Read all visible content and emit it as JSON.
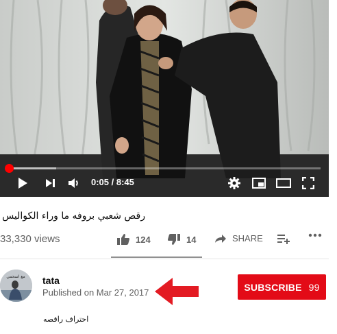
{
  "player": {
    "time": "0:05 / 8:45",
    "progress_fraction": 0.01,
    "buffered_fraction": 0.16
  },
  "video": {
    "title": "رقص شعبي بروفه ما وراء الكواليس",
    "views": "33,330 views"
  },
  "actions": {
    "like_count": "124",
    "dislike_count": "14",
    "share_label": "SHARE"
  },
  "channel": {
    "name": "tata",
    "published": "Published on Mar 27, 2017",
    "avatar_text": "مع اسحمي"
  },
  "subscribe": {
    "label": "SUBSCRIBE",
    "count": "99"
  },
  "description": "احتراف راقصه",
  "colors": {
    "accent_red": "#ff0000",
    "subscribe_red": "#e30b17",
    "arrow_red": "#e31b23"
  }
}
